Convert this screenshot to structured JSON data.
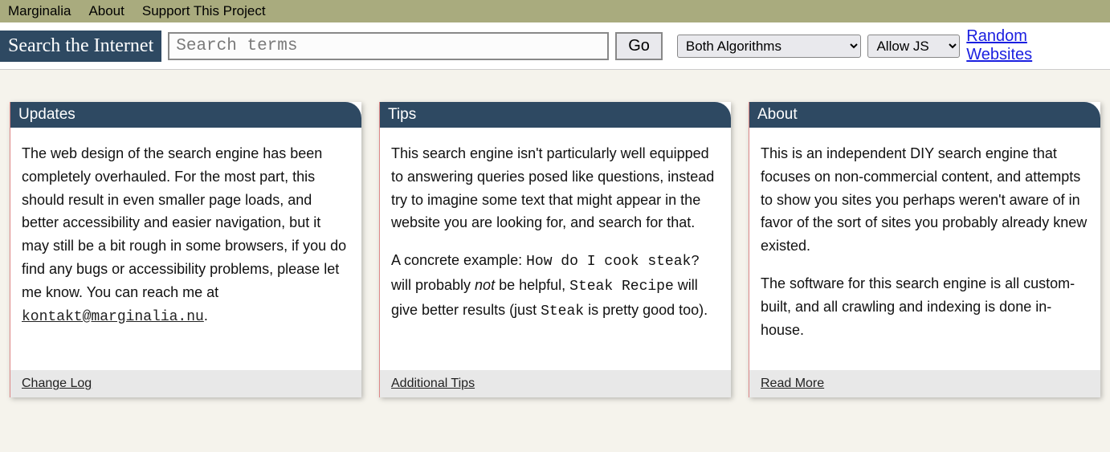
{
  "topnav": {
    "items": [
      {
        "label": "Marginalia"
      },
      {
        "label": "About"
      },
      {
        "label": "Support This Project"
      }
    ]
  },
  "searchbar": {
    "label": "Search the Internet",
    "placeholder": "Search terms",
    "go_label": "Go",
    "select1_value": "Both Algorithms",
    "select2_value": "Allow JS",
    "random_label": "Random Websites"
  },
  "cards": {
    "updates": {
      "title": "Updates",
      "body_pre": "The web design of the search engine has been completely overhauled. For the most part, this should result in even smaller page loads, and better accessibility and easier navigation, but it may still be a bit rough in some browsers, if you do find any bugs or accessibility problems, please let me know. You can reach me at ",
      "email": "kontakt@marginalia.nu",
      "body_post": ".",
      "footer": "Change Log"
    },
    "tips": {
      "title": "Tips",
      "p1": "This search engine isn't particularly well equipped to answering queries posed like questions, instead try to imagine some text that might appear in the website you are looking for, and search for that.",
      "p2_pre": "A concrete example: ",
      "p2_code1": "How do I cook steak?",
      "p2_mid1": " will probably ",
      "p2_not": "not",
      "p2_mid2": " be helpful, ",
      "p2_code2": "Steak Recipe",
      "p2_mid3": " will give better results (just ",
      "p2_code3": "Steak",
      "p2_end": " is pretty good too).",
      "footer": "Additional Tips"
    },
    "about": {
      "title": "About",
      "p1": "This is an independent DIY search engine that focuses on non-commercial content, and attempts to show you sites you perhaps weren't aware of in favor of the sort of sites you probably already knew existed.",
      "p2": "The software for this search engine is all custom-built, and all crawling and indexing is done in-house.",
      "footer": "Read More"
    }
  }
}
